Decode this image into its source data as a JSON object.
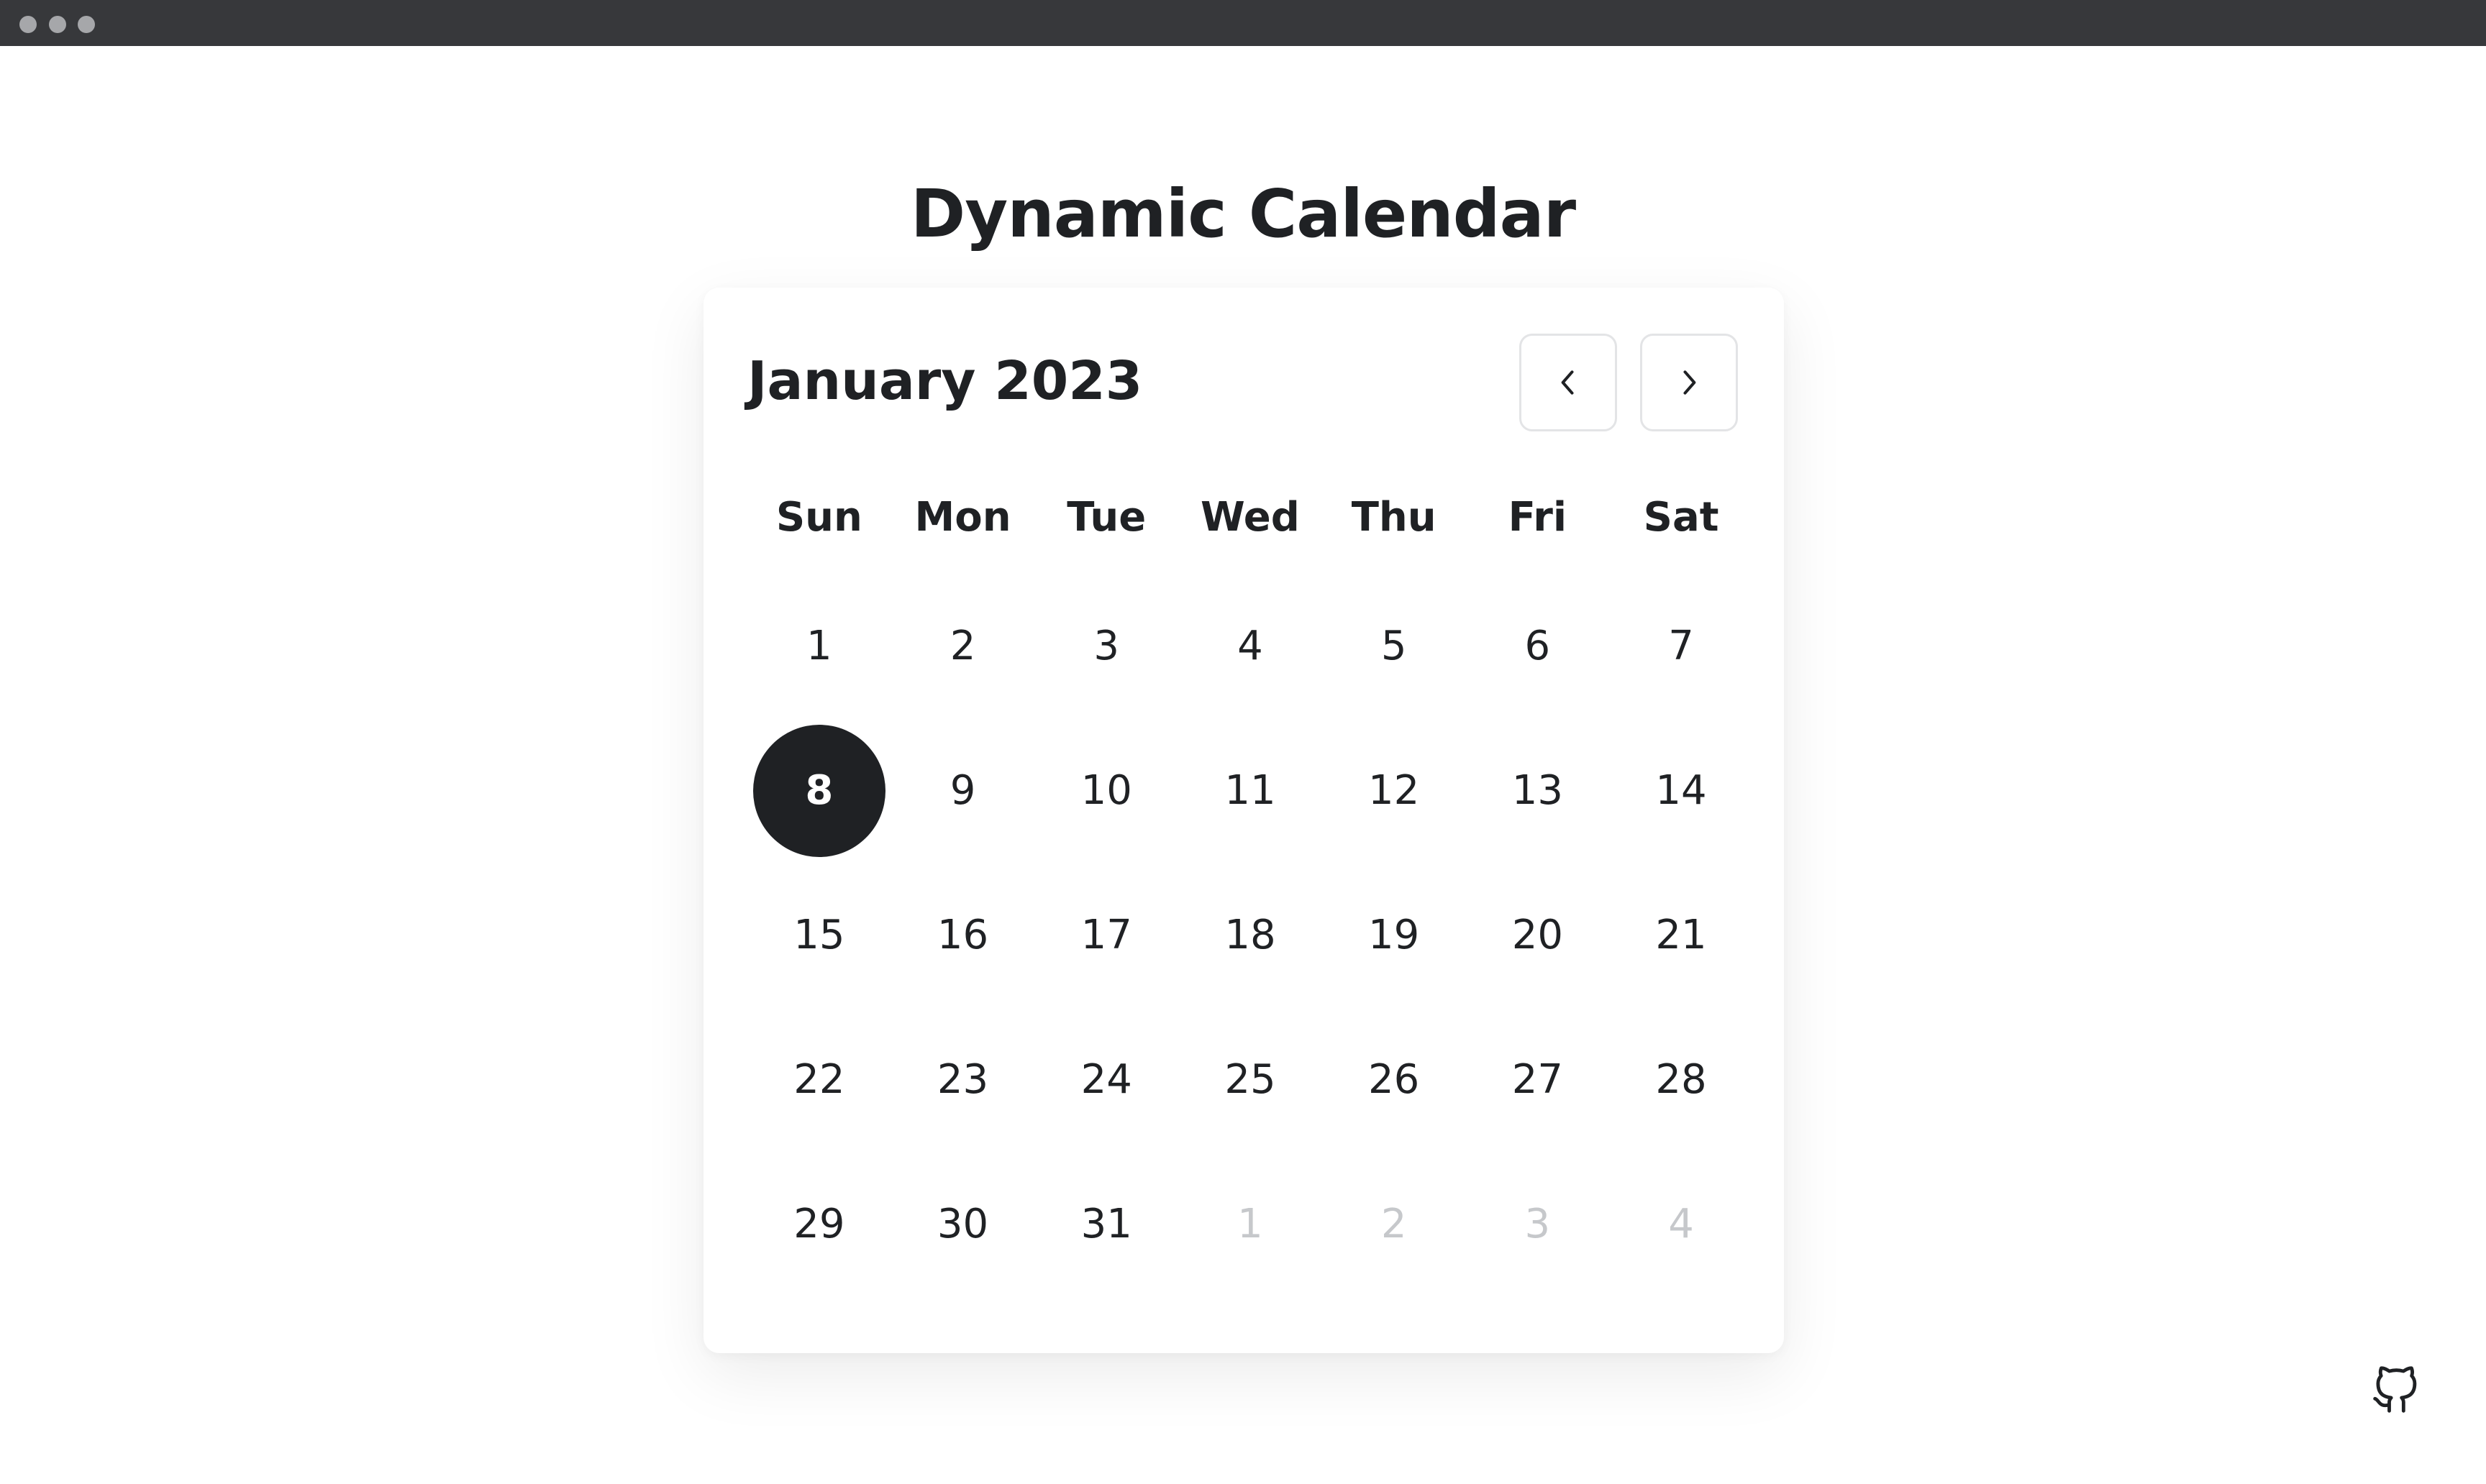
{
  "window": {
    "controls": [
      "window-dot",
      "window-dot",
      "window-dot"
    ]
  },
  "page": {
    "title": "Dynamic Calendar"
  },
  "calendar": {
    "month_label": "January 2023",
    "prev_icon": "chevron-left-icon",
    "next_icon": "chevron-right-icon",
    "weekdays": [
      "Sun",
      "Mon",
      "Tue",
      "Wed",
      "Thu",
      "Fri",
      "Sat"
    ],
    "days": [
      {
        "label": "1",
        "state": "current"
      },
      {
        "label": "2",
        "state": "current"
      },
      {
        "label": "3",
        "state": "current"
      },
      {
        "label": "4",
        "state": "current"
      },
      {
        "label": "5",
        "state": "current"
      },
      {
        "label": "6",
        "state": "current"
      },
      {
        "label": "7",
        "state": "current"
      },
      {
        "label": "8",
        "state": "today"
      },
      {
        "label": "9",
        "state": "current"
      },
      {
        "label": "10",
        "state": "current"
      },
      {
        "label": "11",
        "state": "current"
      },
      {
        "label": "12",
        "state": "current"
      },
      {
        "label": "13",
        "state": "current"
      },
      {
        "label": "14",
        "state": "current"
      },
      {
        "label": "15",
        "state": "current"
      },
      {
        "label": "16",
        "state": "current"
      },
      {
        "label": "17",
        "state": "current"
      },
      {
        "label": "18",
        "state": "current"
      },
      {
        "label": "19",
        "state": "current"
      },
      {
        "label": "20",
        "state": "current"
      },
      {
        "label": "21",
        "state": "current"
      },
      {
        "label": "22",
        "state": "current"
      },
      {
        "label": "23",
        "state": "current"
      },
      {
        "label": "24",
        "state": "current"
      },
      {
        "label": "25",
        "state": "current"
      },
      {
        "label": "26",
        "state": "current"
      },
      {
        "label": "27",
        "state": "current"
      },
      {
        "label": "28",
        "state": "current"
      },
      {
        "label": "29",
        "state": "current"
      },
      {
        "label": "30",
        "state": "current"
      },
      {
        "label": "31",
        "state": "current"
      },
      {
        "label": "1",
        "state": "next-month"
      },
      {
        "label": "2",
        "state": "next-month"
      },
      {
        "label": "3",
        "state": "next-month"
      },
      {
        "label": "4",
        "state": "next-month"
      }
    ]
  },
  "footer": {
    "github_icon": "github-icon"
  },
  "colors": {
    "titlebar": "#37383b",
    "text": "#1f2124",
    "today_bg": "#1f2124",
    "muted_text": "#c6c8cb",
    "button_border": "#e3e4e6"
  }
}
